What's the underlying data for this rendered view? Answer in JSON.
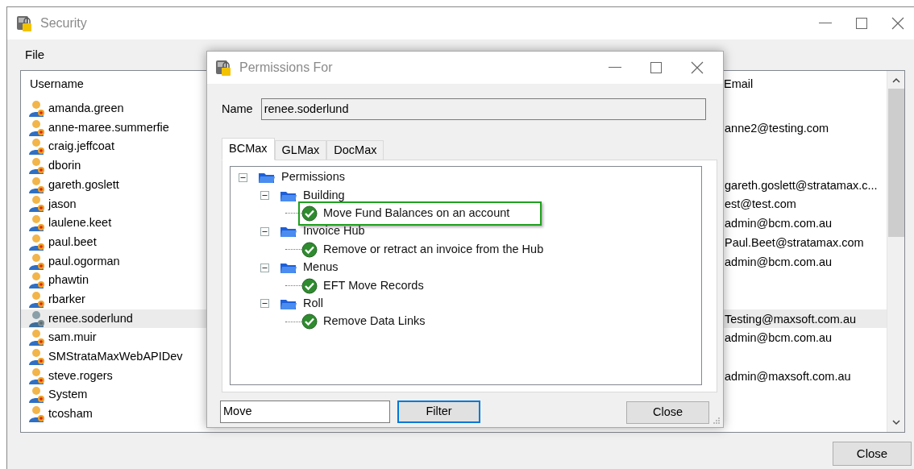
{
  "main_window": {
    "title": "Security",
    "menu": [
      "File"
    ],
    "columns": [
      "Username",
      "Email"
    ],
    "users": [
      {
        "name": "amanda.green",
        "selected": false
      },
      {
        "name": "anne-maree.summerfie",
        "email": "anne2@testing.com",
        "selected": false
      },
      {
        "name": "craig.jeffcoat",
        "selected": false
      },
      {
        "name": "dborin",
        "selected": false
      },
      {
        "name": "gareth.goslett",
        "email": "gareth.goslett@stratamax.c...",
        "selected": false
      },
      {
        "name": "jason",
        "email": "est@test.com",
        "selected": false
      },
      {
        "name": "laulene.keet",
        "email": "admin@bcm.com.au",
        "selected": false
      },
      {
        "name": "paul.beet",
        "email": "Paul.Beet@stratamax.com",
        "selected": false
      },
      {
        "name": "paul.ogorman",
        "email": "admin@bcm.com.au",
        "selected": false
      },
      {
        "name": "phawtin",
        "selected": false
      },
      {
        "name": "rbarker",
        "selected": false
      },
      {
        "name": "renee.soderlund",
        "email": "Testing@maxsoft.com.au",
        "selected": true
      },
      {
        "name": "sam.muir",
        "email": "admin@bcm.com.au",
        "selected": false
      },
      {
        "name": "SMStrataMaxWebAPIDev",
        "selected": false
      },
      {
        "name": "steve.rogers",
        "email": "admin@maxsoft.com.au",
        "selected": false
      },
      {
        "name": "System",
        "selected": false
      },
      {
        "name": "tcosham",
        "selected": false
      }
    ],
    "close_button": "Close"
  },
  "dialog": {
    "title": "Permissions For",
    "name_label": "Name",
    "name_value": "renee.soderlund",
    "tabs": [
      {
        "label": "BCMax",
        "selected": true
      },
      {
        "label": "GLMax",
        "selected": false
      },
      {
        "label": "DocMax",
        "selected": false
      }
    ],
    "tree": [
      {
        "label": "Permissions",
        "kind": "group",
        "expanded": true,
        "children": [
          {
            "label": "Building",
            "kind": "group",
            "expanded": true,
            "children": [
              {
                "label": "Move Fund Balances on an account",
                "kind": "permission",
                "highlighted": true
              }
            ]
          },
          {
            "label": "Invoice Hub",
            "kind": "group",
            "expanded": true,
            "children": [
              {
                "label": "Remove or retract an invoice from the Hub",
                "kind": "permission",
                "highlighted": false
              }
            ]
          },
          {
            "label": "Menus",
            "kind": "group",
            "expanded": true,
            "children": [
              {
                "label": "EFT Move Records",
                "kind": "permission",
                "highlighted": false
              }
            ]
          },
          {
            "label": "Roll",
            "kind": "group",
            "expanded": true,
            "children": [
              {
                "label": "Remove Data Links",
                "kind": "permission",
                "highlighted": false
              }
            ]
          }
        ]
      }
    ],
    "filter_value": "Move",
    "filter_button": {
      "label": "Filter",
      "focused": true
    },
    "close_button": "Close"
  }
}
